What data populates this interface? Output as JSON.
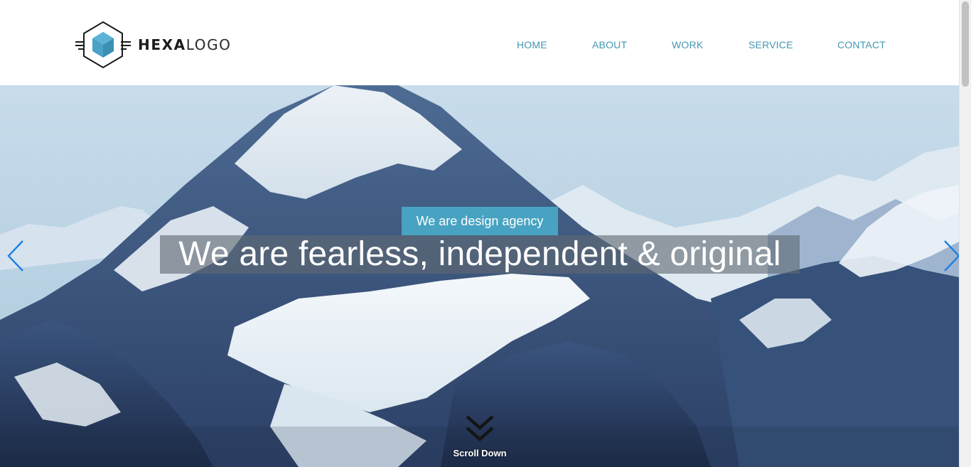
{
  "logo": {
    "text_bold": "HEXA",
    "text_light": "LOGO",
    "icon": "hexagon-cube-icon",
    "accent_color": "#4aa2c6"
  },
  "nav": {
    "items": [
      {
        "label": "HOME"
      },
      {
        "label": "ABOUT"
      },
      {
        "label": "WORK"
      },
      {
        "label": "SERVICE"
      },
      {
        "label": "CONTACT"
      }
    ],
    "color": "#4497b3"
  },
  "hero": {
    "tagline": "We are design agency",
    "headline": "We are fearless, independent & original",
    "tagline_bg": "#48a3c2",
    "prev_icon": "chevron-left-icon",
    "next_icon": "chevron-right-icon",
    "arrow_color": "#1e7fe0",
    "background_image": "snowy-mountain-peaks"
  },
  "scroll": {
    "label": "Scroll Down",
    "icon": "double-chevron-down-icon"
  }
}
